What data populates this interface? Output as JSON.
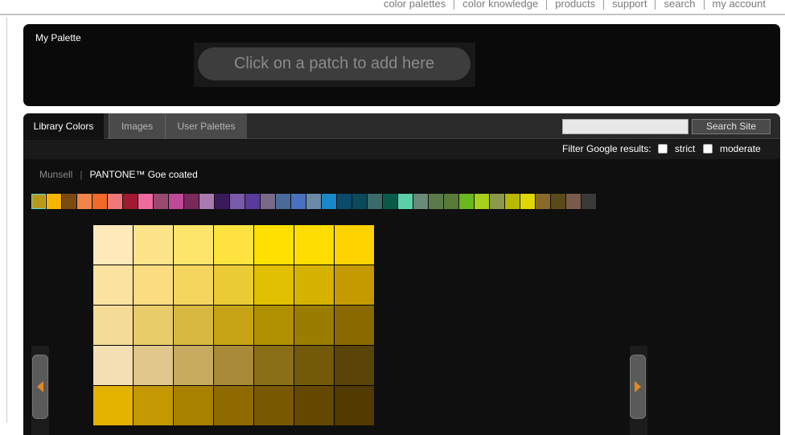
{
  "topnav": [
    "color palettes",
    "color knowledge",
    "products",
    "support",
    "search",
    "my account"
  ],
  "palette": {
    "title": "My Palette",
    "dropzone_text": "Click on a patch to add here"
  },
  "tabs": [
    "Library Colors",
    "Images",
    "User Palettes"
  ],
  "search": {
    "value": "",
    "button": "Search Site"
  },
  "filter": {
    "label": "Filter Google results:",
    "strict": "strict",
    "moderate": "moderate"
  },
  "libraries": {
    "first": "Munsell",
    "separator": "|",
    "current": "PANTONE™ Goe coated"
  },
  "hue_strip": [
    "#b89a1a",
    "#f5b500",
    "#7a4a10",
    "#f0844a",
    "#f06a28",
    "#f07878",
    "#a01a30",
    "#f06aa0",
    "#9a4a70",
    "#c04a9a",
    "#7a2a5a",
    "#a87ab0",
    "#3a1a5a",
    "#7a5aaa",
    "#5a3a9a",
    "#7a6a8a",
    "#4a6a9a",
    "#4a70c0",
    "#6a8aa8",
    "#1a88c8",
    "#0a4a6a",
    "#0a4a5a",
    "#3a6a6a",
    "#0a5a4a",
    "#5ad0a8",
    "#6a8a7a",
    "#5a7a4a",
    "#5a7a3a",
    "#6ab820",
    "#a8d01a",
    "#8a9a4a",
    "#b8b800",
    "#e0d800",
    "#8a6a2a",
    "#5a4a1a",
    "#7a5a4a",
    "#3a3a3a"
  ],
  "grid_colors": [
    [
      "#ffe9b8",
      "#fde48a",
      "#fde46a",
      "#fde240",
      "#ffe000",
      "#ffdd00",
      "#ffd300"
    ],
    [
      "#fce2a0",
      "#fcdc80",
      "#f5d460",
      "#ebcb35",
      "#e0c000",
      "#d5b200",
      "#c49a00"
    ],
    [
      "#f4dc96",
      "#e8cb6a",
      "#d8b840",
      "#c6a415",
      "#b09000",
      "#9a7c00",
      "#8a6a00"
    ],
    [
      "#f4dfb4",
      "#e0c68a",
      "#c6aa60",
      "#a88a38",
      "#8a6e18",
      "#725a0a",
      "#5a4408"
    ],
    [
      "#e4b300",
      "#c49800",
      "#a88100",
      "#8e6a00",
      "#7a5800",
      "#644800",
      "#533a00"
    ]
  ]
}
